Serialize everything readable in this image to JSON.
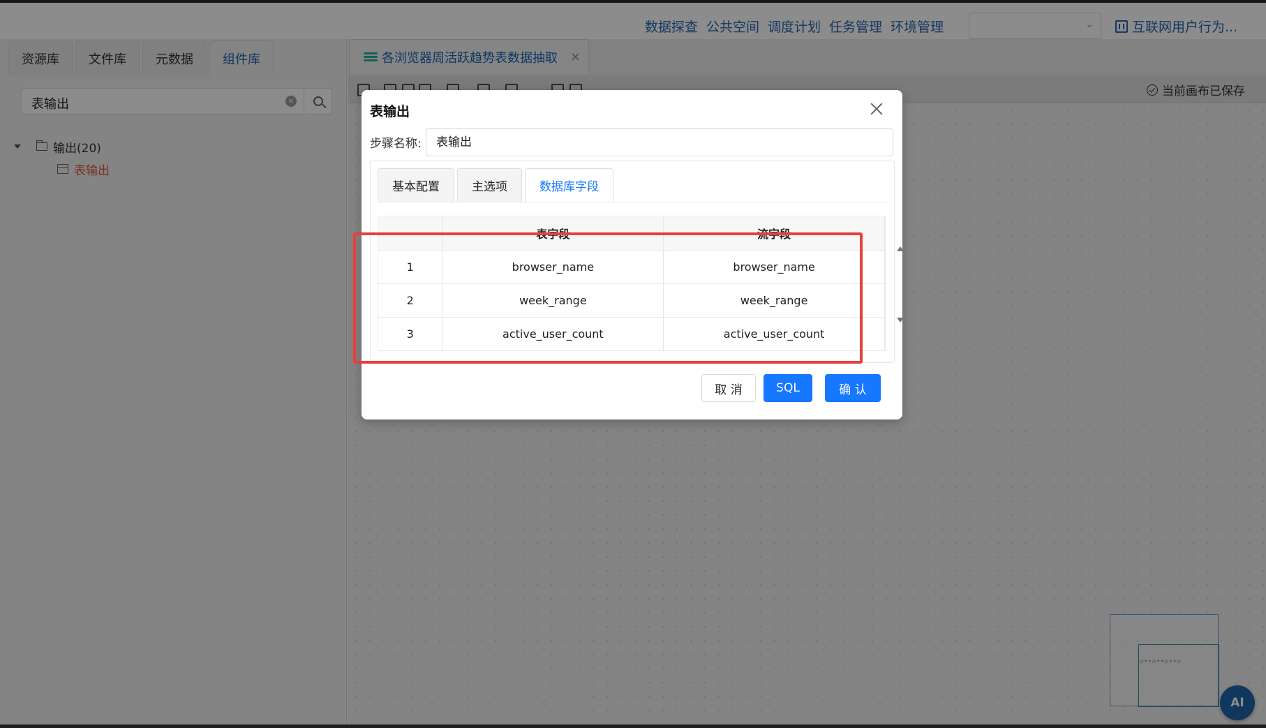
{
  "topnav": {
    "items": [
      "数据探查",
      "公共空间",
      "调度计划",
      "任务管理",
      "环境管理"
    ],
    "select_value": "",
    "project": "互联网用户行为..."
  },
  "left": {
    "tabs": [
      "资源库",
      "文件库",
      "元数据",
      "组件库"
    ],
    "active_tab": "组件库",
    "search_value": "表输出",
    "tree": {
      "folder": "输出(20)",
      "child": "表输出"
    }
  },
  "editor": {
    "tab_title": "各浏览器周活跃趋势表数据抽取",
    "saved_status": "当前画布已保存",
    "ai_label": "AI"
  },
  "modal": {
    "title": "表输出",
    "step_label": "步骤名称:",
    "step_value": "表输出",
    "tabs": [
      "基本配置",
      "主选项",
      "数据库字段"
    ],
    "active_tab": "数据库字段",
    "columns": [
      "",
      "表字段",
      "流字段"
    ],
    "rows": [
      {
        "idx": "1",
        "table_field": "browser_name",
        "stream_field": "browser_name"
      },
      {
        "idx": "2",
        "table_field": "week_range",
        "stream_field": "week_range"
      },
      {
        "idx": "3",
        "table_field": "active_user_count",
        "stream_field": "active_user_count"
      }
    ],
    "buttons": {
      "cancel": "取 消",
      "sql": "SQL",
      "ok": "确 认"
    }
  },
  "colors": {
    "accent": "#1677ff",
    "link": "#2a66ad",
    "highlight": "#e8403d",
    "tree_active": "#d9572b"
  }
}
